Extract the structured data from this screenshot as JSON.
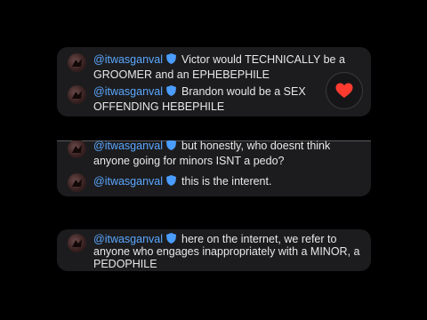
{
  "comments": [
    {
      "username": "@itwasganval",
      "line1": "Victor would TECHNICALLY be a",
      "line2": "GROOMER and an EPHEBEPHILE"
    },
    {
      "username": "@itwasganval",
      "line1": "Brandon would be a SEX",
      "line2": "OFFENDING HEBEPHILE"
    },
    {
      "username": "@itwasganval",
      "line1": "but honestly, who doesnt think",
      "line2": "anyone going for minors ISNT a pedo?"
    },
    {
      "username": "@itwasganval",
      "line1": "this is the interent.",
      "line2": ""
    },
    {
      "username": "@itwasganval",
      "line1": "here on the internet, we refer to",
      "line2": "anyone who engages inappropriately with a MINOR, a",
      "line3": "PEDOPHILE"
    }
  ],
  "reaction": {
    "icon": "heart-icon",
    "color": "#ff3b30"
  },
  "colors": {
    "background": "#000000",
    "card": "#1c1c1e",
    "username": "#5ba7ff",
    "text": "#e8e8e8"
  }
}
